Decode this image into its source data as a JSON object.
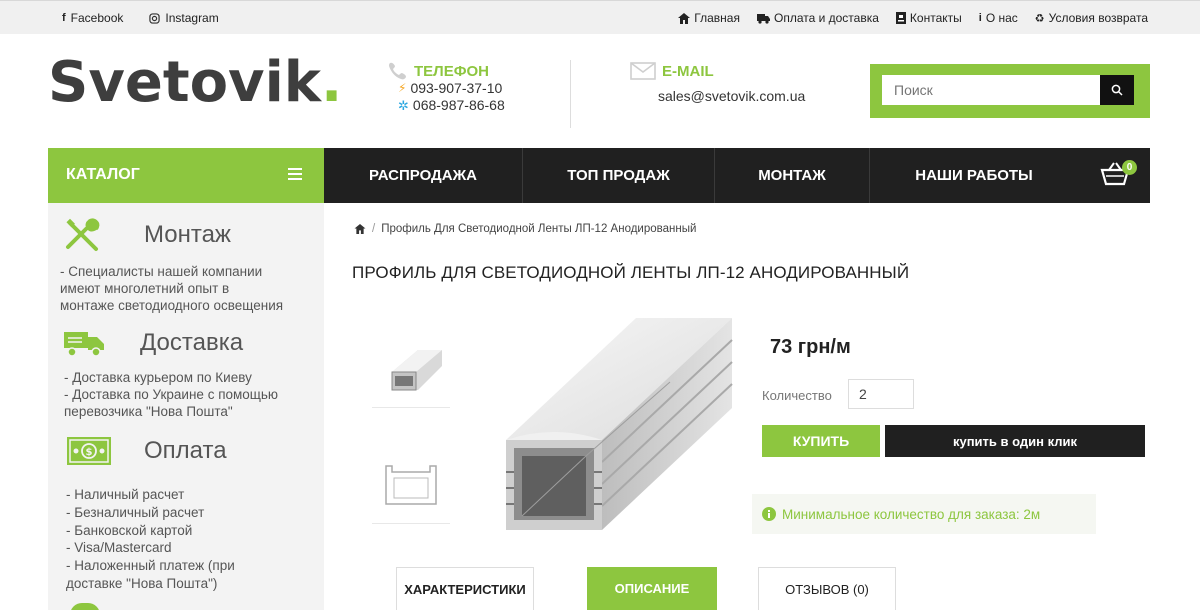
{
  "topbar": {
    "social": [
      {
        "icon": "facebook-icon",
        "label": "Facebook"
      },
      {
        "icon": "instagram-icon",
        "label": "Instagram"
      }
    ],
    "links": [
      {
        "icon": "home-icon",
        "label": "Главная"
      },
      {
        "icon": "truck-icon",
        "label": "Оплата и доставка"
      },
      {
        "icon": "contact-card-icon",
        "label": "Контакты"
      },
      {
        "icon": "info-icon",
        "label": "О нас"
      },
      {
        "icon": "recycle-icon",
        "label": "Условия возврата"
      }
    ]
  },
  "header": {
    "logo_text": "Svetovik",
    "logo_dot": ".",
    "phone_title": "ТЕЛЕФОН",
    "phone1": "093-907-37-10",
    "phone2": "068-987-86-68",
    "email_title": "E-MAIL",
    "email": "sales@svetovik.com.ua",
    "search_placeholder": "Поиск"
  },
  "nav": {
    "catalog": "КАТАЛОГ",
    "items": [
      "РАСПРОДАЖА",
      "ТОП ПРОДАЖ",
      "МОНТАЖ",
      "НАШИ РАБОТЫ"
    ],
    "cart_count": "0"
  },
  "sidebar": {
    "montazh": {
      "title": "Монтаж",
      "lines": [
        "- Специалисты нашей компании",
        "имеют многолетний опыт в",
        "монтаже светодиодного освещения"
      ]
    },
    "dostavka": {
      "title": "Доставка",
      "lines": [
        "- Доставка курьером по Киеву",
        "- Доставка по Украине с помощью",
        "перевозчика \"Нова Пошта\""
      ]
    },
    "oplata": {
      "title": "Оплата",
      "lines": [
        "- Наличный расчет",
        "- Безналичный расчет",
        "- Банковской картой",
        "- Visa/Mastercard",
        "- Наложенный платеж (при",
        "доставке \"Нова Пошта\")"
      ]
    }
  },
  "product": {
    "breadcrumb_sep": "/",
    "breadcrumb": "Профиль Для Светодиодной Ленты ЛП-12 Анодированный",
    "title": "ПРОФИЛЬ ДЛЯ СВЕТОДИОДНОЙ ЛЕНТЫ  ЛП-12 АНОДИРОВАННЫЙ",
    "price": "73 грн/м",
    "qty_label": "Количество",
    "qty_value": "2",
    "buy": "КУПИТЬ",
    "one_click": "купить в один клик",
    "min_order": "Минимальное количество для заказа: 2м"
  },
  "tabs": [
    "ХАРАКТЕРИСТИКИ",
    "ОПИСАНИЕ",
    "ОТЗЫВОВ (0)"
  ],
  "colors": {
    "accent": "#8dc63f",
    "dark": "#202020",
    "sidebar_bg": "#f3f3f3"
  }
}
